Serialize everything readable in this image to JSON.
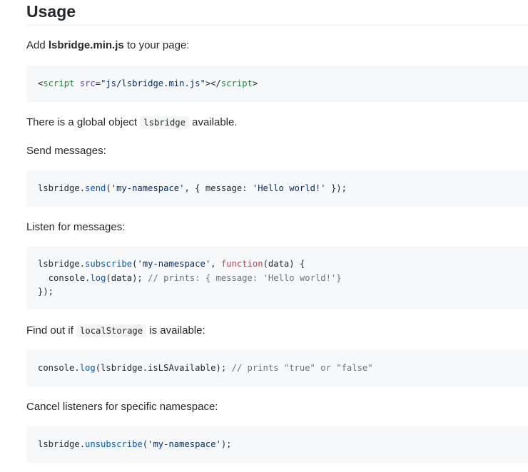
{
  "heading": "Usage",
  "steps": {
    "add": {
      "prefix": "Add ",
      "bold": "lsbridge.min.js",
      "suffix": " to your page:"
    },
    "global": {
      "prefix": "There is a global object ",
      "code": "lsbridge",
      "suffix": " available."
    },
    "send_label": "Send messages:",
    "listen_label": "Listen for messages:",
    "find": {
      "prefix": "Find out if ",
      "code": "localStorage",
      "suffix": " is available:"
    },
    "cancel_label": "Cancel listeners for specific namespace:"
  },
  "code_blocks": {
    "script_tag": {
      "open_lt": "<",
      "tag": "script",
      "attr": " src",
      "eq": "=",
      "value": "\"js/lsbridge.min.js\"",
      "close_open": "></",
      "close_tag": "script",
      "gt": ">"
    },
    "send": {
      "obj": "lsbridge.",
      "fn": "send",
      "open": "(",
      "ns": "'my-namespace'",
      "mid": ", { message: ",
      "msg": "'Hello world!'",
      "end": " });"
    },
    "subscribe": {
      "line1_obj": "lsbridge.",
      "line1_fn": "subscribe",
      "line1_open": "(",
      "line1_ns": "'my-namespace'",
      "line1_sep": ", ",
      "line1_kw": "function",
      "line1_end": "(data) {",
      "line2_indent": "  ",
      "line2_obj": "console.",
      "line2_fn": "log",
      "line2_args": "(data); ",
      "line2_com": "// prints: { message: 'Hello world!'}",
      "line3": "});"
    },
    "is_available": {
      "obj": "console.",
      "fn": "log",
      "args": "(lsbridge.isLSAvailable); ",
      "com": "// prints \"true\" or \"false\""
    },
    "unsubscribe": {
      "obj": "lsbridge.",
      "fn": "unsubscribe",
      "open": "(",
      "ns": "'my-namespace'",
      "end": ");"
    }
  }
}
